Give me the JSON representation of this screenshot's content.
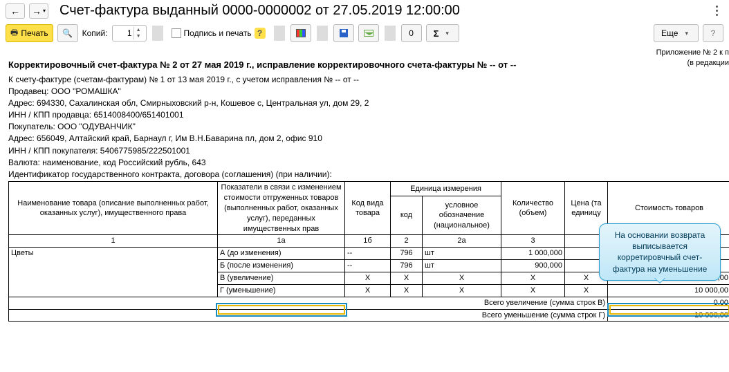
{
  "title": "Счет-фактура выданный 0000-0000002 от 27.05.2019 12:00:00",
  "nav": {
    "back": "←",
    "fwd": "→",
    "fwd_drop": "▾"
  },
  "toolbar": {
    "print": "Печать",
    "copies_label": "Копий:",
    "copies_value": "1",
    "sign_print": "Подпись и печать",
    "more": "Еще"
  },
  "appendix": {
    "l1": "Приложение № 2 к п",
    "l2": "(в редакции"
  },
  "doc": {
    "heading": "Корректировочный счет-фактура № 2 от 27 мая 2019 г., исправление корректировочного счета-фактуры № -- от --",
    "ref": "К счету-фактуре (счетам-фактурам) № 1 от 13 мая 2019 г., с учетом исправления № -- от --",
    "seller": "Продавец: ООО \"РОМАШКА\"",
    "seller_addr": "Адрес: 694330, Сахалинская обл, Смирныховский р-н, Кошевое с, Центральная ул, дом 29, 2",
    "seller_inn": "ИНН / КПП продавца: 6514008400/651401001",
    "buyer": "Покупатель: ООО \"ОДУВАНЧИК\"",
    "buyer_addr": "Адрес: 656049, Алтайский край, Барнаул г, Им В.Н.Баварина пл, дом 2, офис 910",
    "buyer_inn": "ИНН / КПП покупателя: 5406775985/222501001",
    "currency": "Валюта: наименование, код Российский рубль, 643",
    "contract": "Идентификатор государственного контракта, договора (соглашения) (при наличии):"
  },
  "hdr": {
    "name": "Наименование товара (описание выполненных работ, оказанных услуг), имущественного права",
    "change": "Показатели в связи с изменением стоимости отгруженных товаров (выполненных работ, оказанных услуг), переданных имущественных прав",
    "type_code": "Код вида товара",
    "unit": "Единица измерения",
    "unit_code": "код",
    "unit_name": "условное обозначение (национальное)",
    "qty": "Количество (объем)",
    "price": "Цена (та единицу",
    "cost": "Стоимость товаров"
  },
  "hnum": {
    "c1": "1",
    "c1a": "1а",
    "c1b": "1б",
    "c2": "2",
    "c2a": "2а",
    "c3": "3"
  },
  "rows": {
    "item": "Цветы",
    "a": {
      "lbl": "А (до изменения)",
      "type": "--",
      "code": "796",
      "unit": "шт",
      "qty": "1 000,000"
    },
    "b": {
      "lbl": "Б (после изменения)",
      "type": "--",
      "code": "796",
      "unit": "шт",
      "qty": "900,000"
    },
    "v": {
      "lbl": "В (увеличение)",
      "x1": "X",
      "x2": "X",
      "x3": "X",
      "x4": "X",
      "x5": "X",
      "cost": "0,00"
    },
    "g": {
      "lbl": "Г (уменьшение)",
      "x1": "X",
      "x2": "X",
      "x3": "X",
      "x4": "X",
      "x5": "X",
      "cost": "10 000,00"
    }
  },
  "totals": {
    "inc_lbl": "Всего увеличение (сумма строк В)",
    "inc_val": "0,00",
    "dec_lbl": "Всего уменьшение (сумма строк Г)",
    "dec_val": "10 000,00"
  },
  "callout": "На основании возврата выписывается корретировчный счет-фактура на уменьшение"
}
